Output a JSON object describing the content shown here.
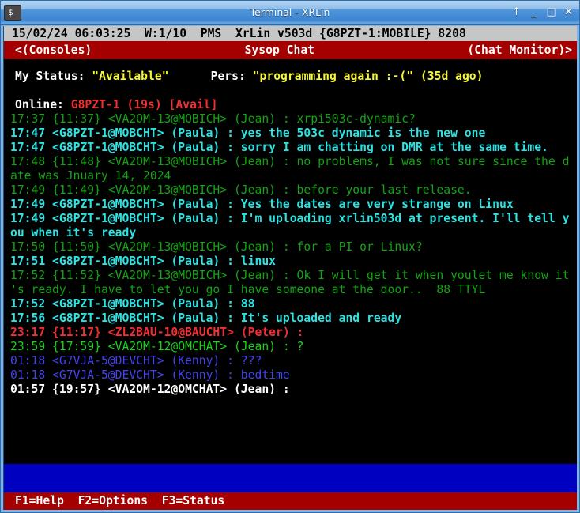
{
  "window": {
    "title": "Terminal - XRLin",
    "icon": "terminal-icon",
    "icon_glyph": "$_",
    "buttons": [
      {
        "name": "shade-button",
        "glyph": "↑"
      },
      {
        "name": "minimize-button",
        "glyph": "_"
      },
      {
        "name": "maximize-button",
        "glyph": "□"
      },
      {
        "name": "close-button",
        "glyph": "✕"
      }
    ]
  },
  "statusbar": {
    "text": "15/02/24 06:03:25  W:1/10  PMS  XrLin v503d {G8PZT-1:MOBILE} 8208",
    "date": "15/02/24",
    "time": "06:03:25",
    "window_counter": "W:1/10",
    "mode": "PMS",
    "app": "XrLin v503d",
    "node": "{G8PZT-1:MOBILE}",
    "port": "8208"
  },
  "chat_header": {
    "left": "<(Consoles)",
    "center": "Sysop Chat",
    "right": "(Chat Monitor)>"
  },
  "info": {
    "status_label": "My Status:",
    "status_value": "\"Available\"",
    "pers_label": "Pers:",
    "pers_value": "\"programming again :-(\" (35d ago)",
    "online_label": "Online:",
    "online_value": "G8PZT-1 (19s) [Avail]"
  },
  "log_lines": [
    {
      "color": "green",
      "text": "17:37 {11:37} <VA2OM-13@MOBICH> (Jean) : xrpi503c-dynamic?"
    },
    {
      "color": "cyan",
      "text": "17:47 <G8PZT-1@MOBCHT> (Paula) : yes the 503c dynamic is the new one"
    },
    {
      "color": "cyan",
      "text": "17:47 <G8PZT-1@MOBCHT> (Paula) : sorry I am chatting on DMR at the same time."
    },
    {
      "color": "green",
      "text": "17:48 {11:48} <VA2OM-13@MOBICH> (Jean) : no problems, I was not sure since the d"
    },
    {
      "color": "green",
      "text": "ate was Jnuary 14, 2024"
    },
    {
      "color": "green",
      "text": "17:49 {11:49} <VA2OM-13@MOBICH> (Jean) : before your last release."
    },
    {
      "color": "cyan",
      "text": "17:49 <G8PZT-1@MOBCHT> (Paula) : Yes the dates are very strange on Linux"
    },
    {
      "color": "cyan",
      "text": "17:49 <G8PZT-1@MOBCHT> (Paula) : I'm uploading xrlin503d at present. I'll tell y"
    },
    {
      "color": "cyan",
      "text": "ou when it's ready"
    },
    {
      "color": "green",
      "text": "17:50 {11:50} <VA2OM-13@MOBICH> (Jean) : for a PI or Linux?"
    },
    {
      "color": "cyan",
      "text": "17:51 <G8PZT-1@MOBCHT> (Paula) : linux"
    },
    {
      "color": "green",
      "text": "17:52 {11:52} <VA2OM-13@MOBICH> (Jean) : Ok I will get it when youlet me know it"
    },
    {
      "color": "green",
      "text": "'s ready. I have to let you go I have someone at the door..  88 TTYL"
    },
    {
      "color": "cyan",
      "text": "17:52 <G8PZT-1@MOBCHT> (Paula) : 88"
    },
    {
      "color": "cyan",
      "text": "17:56 <G8PZT-1@MOBCHT> (Paula) : It's uploaded and ready"
    },
    {
      "color": "red",
      "text": "23:17 {11:17} <ZL2BAU-10@BAUCHT> (Peter) :"
    },
    {
      "color": "bgreen",
      "text": "23:59 {17:59} <VA2OM-12@OMCHAT> (Jean) : ?"
    },
    {
      "color": "blue",
      "text": "01:18 <G7VJA-5@DEVCHT> (Kenny) : ???"
    },
    {
      "color": "blue",
      "text": "01:18 <G7VJA-5@DEVCHT> (Kenny) : bedtime"
    },
    {
      "color": "white",
      "text": "01:57 {19:57} <VA2OM-12@OMCHAT> (Jean) :"
    }
  ],
  "compose": {
    "value": ""
  },
  "fkeys": {
    "text": "F1=Help  F2=Options  F3=Status",
    "items": [
      "F1=Help",
      "F2=Options",
      "F3=Status"
    ]
  },
  "colors": {
    "titlebar_blue": "#4f96dc",
    "status_grey": "#c6c6c6",
    "header_red": "#a50000",
    "compose_blue": "#0000c0",
    "terminal_black": "#000000",
    "green": "#12a512",
    "bright_green": "#17d717",
    "cyan": "#2ee2e2",
    "red": "#f03030",
    "blue": "#4444ee",
    "yellow": "#f7f733",
    "white": "#ffffff"
  }
}
